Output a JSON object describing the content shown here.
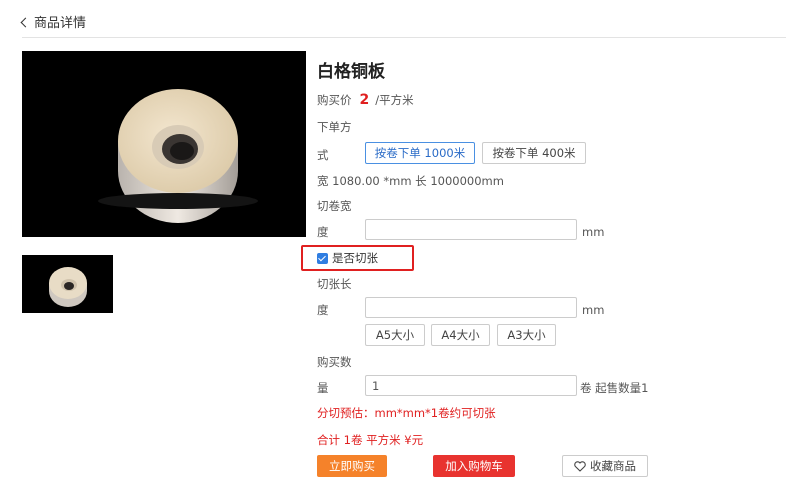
{
  "header": {
    "back_label": "商品详情"
  },
  "product": {
    "title": "白格铜板",
    "price_label": "购买价",
    "price_value": "2",
    "price_unit": "/平方米"
  },
  "order_method": {
    "label_line1": "下单方",
    "label_line2": "式",
    "options": [
      "按卷下单 1000米",
      "按卷下单 400米"
    ],
    "selected": "按卷下单 1000米"
  },
  "dimensions_text": "宽 1080.00 *mm 长 1000000mm",
  "cut_width": {
    "label_line1": "切卷宽",
    "label_line2": "度",
    "value": "",
    "unit": "mm"
  },
  "cut_sheet": {
    "label": "是否切张",
    "checked": true
  },
  "cut_length": {
    "label_line1": "切张长",
    "label_line2": "度",
    "value": "",
    "unit": "mm",
    "size_options": [
      "A5大小",
      "A4大小",
      "A3大小"
    ]
  },
  "quantity": {
    "label_line1": "购买数",
    "label_line2": "量",
    "value": "1",
    "unit_text": "卷 起售数量1"
  },
  "estimate_text": "分切预估：mm*mm*1卷约可切张",
  "total_text": "合计 1卷 平方米 ¥元",
  "actions": {
    "buy_now": "立即购买",
    "add_to_cart": "加入购物车",
    "favorite": "收藏商品"
  },
  "colors": {
    "accent_red": "#e02020",
    "buy_orange": "#f5822a",
    "cart_red": "#e8332f",
    "selected_blue": "#4a90e2"
  }
}
